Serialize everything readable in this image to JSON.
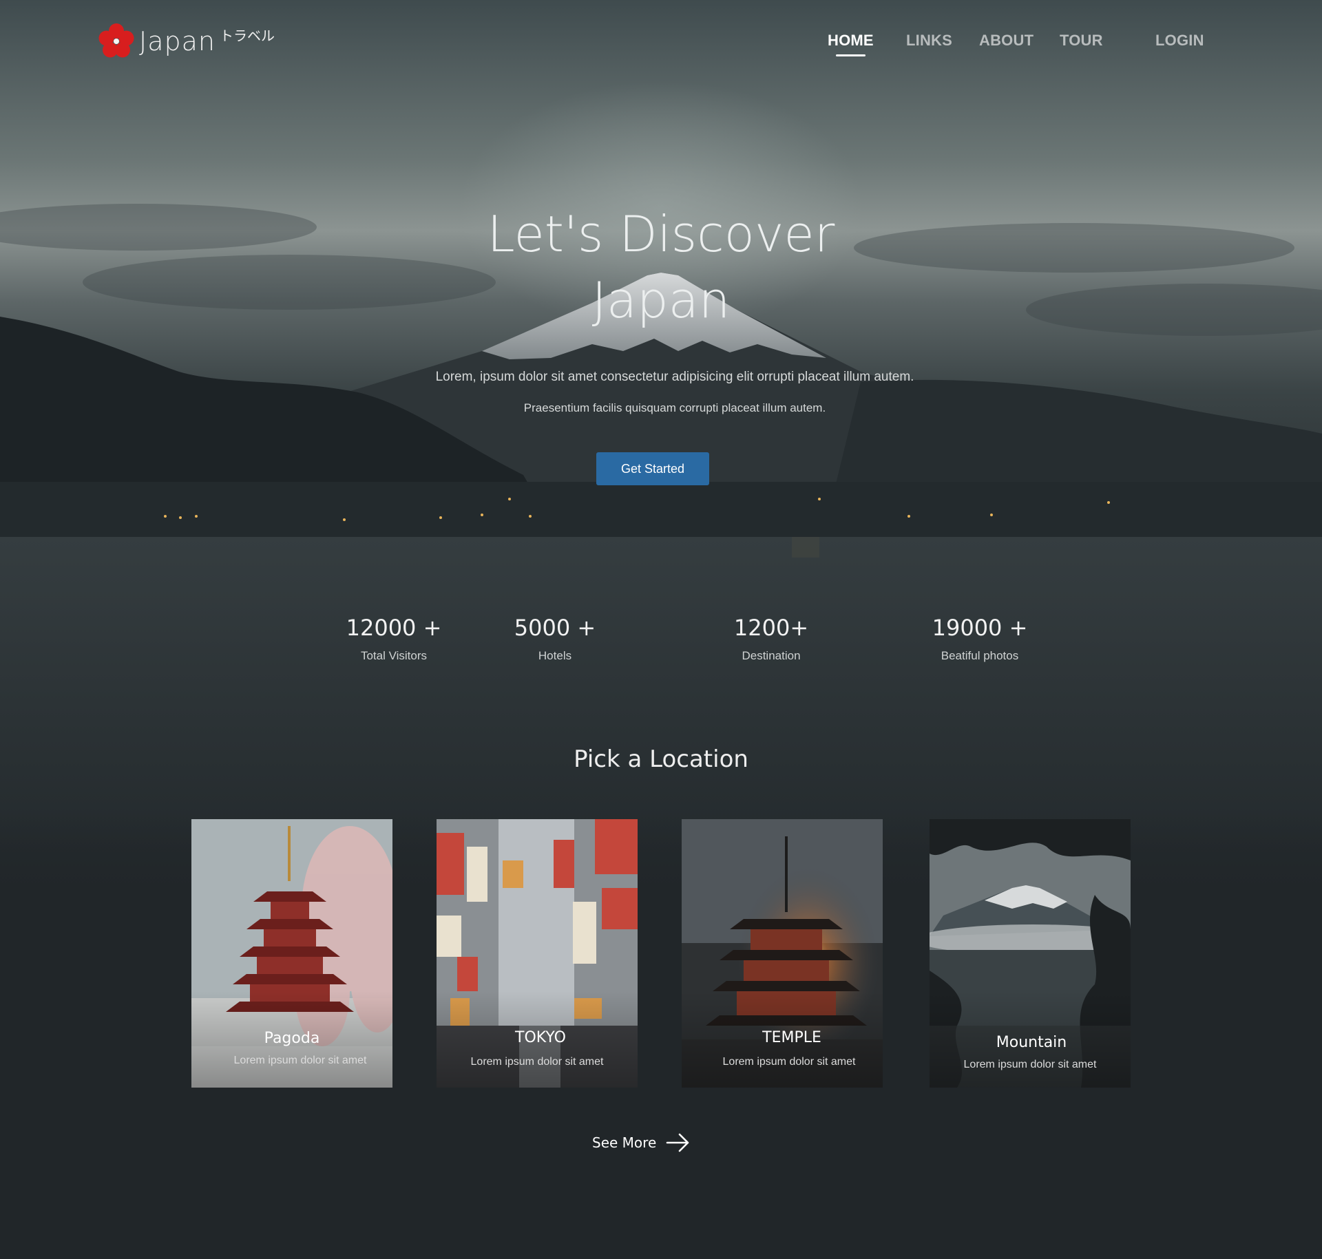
{
  "brand": {
    "name": "Japan",
    "kana": "トラベル",
    "accent_color": "#d81e1e"
  },
  "nav": {
    "items": [
      {
        "label": "HOME",
        "active": true
      },
      {
        "label": "LINKS",
        "active": false
      },
      {
        "label": "ABOUT",
        "active": false
      },
      {
        "label": "TOUR",
        "active": false
      }
    ],
    "login_label": "LOGIN"
  },
  "hero": {
    "title_line1": "Let's Discover",
    "title_line2": "Japan",
    "subtitle_line1": "Lorem, ipsum dolor sit amet consectetur adipisicing elit  orrupti placeat illum autem.",
    "subtitle_line2": "Praesentium facilis quisquam corrupti placeat illum autem.",
    "cta_label": "Get Started",
    "cta_color": "#2a6aa3"
  },
  "stats": [
    {
      "value": "12000 +",
      "label": "Total Visitors"
    },
    {
      "value": "5000 +",
      "label": "Hotels"
    },
    {
      "value": "1200+",
      "label": "Destination"
    },
    {
      "value": "19000 +",
      "label": "Beatiful photos"
    }
  ],
  "locations": {
    "title": "Pick a Location",
    "cards": [
      {
        "title": "Pagoda",
        "description": "Lorem ipsum dolor sit amet",
        "image": "pagoda-with-cherry-blossom"
      },
      {
        "title": "TOKYO",
        "description": "Lorem ipsum dolor sit amet",
        "image": "tokyo-street-signs"
      },
      {
        "title": "TEMPLE",
        "description": "Lorem ipsum dolor sit amet",
        "image": "temple-pagoda-at-sunset"
      },
      {
        "title": "Mountain",
        "description": "Lorem ipsum dolor sit amet",
        "image": "mount-fuji-through-trees"
      }
    ],
    "see_more_label": "See More"
  }
}
